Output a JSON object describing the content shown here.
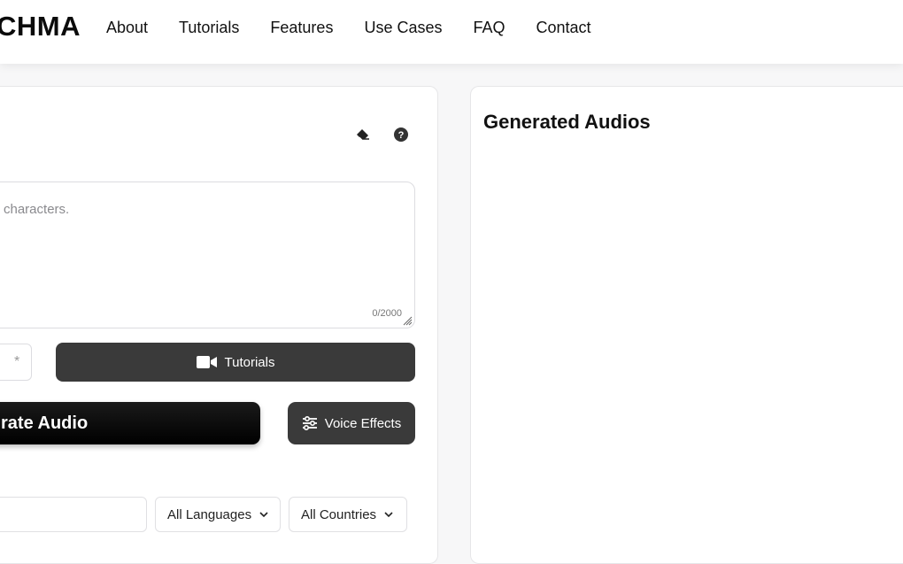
{
  "header": {
    "logo": "CHMA",
    "nav": [
      "About",
      "Tutorials",
      "Features",
      "Use Cases",
      "FAQ",
      "Contact"
    ]
  },
  "editor": {
    "placeholder": "characters.",
    "counter": "0/2000",
    "speed_symbol": "*",
    "tutorials_label": "Tutorials",
    "generate_label": "rate Audio",
    "effects_label": "Voice Effects",
    "filters": {
      "language": "All Languages",
      "country": "All Countries"
    }
  },
  "results": {
    "title": "Generated Audios"
  },
  "icons": {
    "eraser": "eraser-icon",
    "help": "help-icon",
    "video": "video-camera-icon",
    "sliders": "sliders-icon",
    "chevron": "chevron-down-icon"
  }
}
